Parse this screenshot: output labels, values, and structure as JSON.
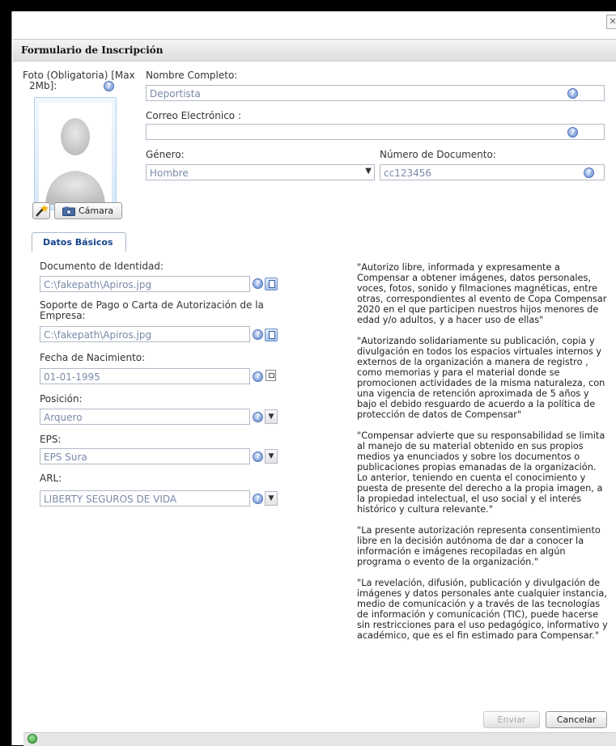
{
  "window": {
    "close_glyph": "✕"
  },
  "panel": {
    "title": "Formulario de Inscripción"
  },
  "photo": {
    "label_line1": "Foto (Obligatoria) [Max",
    "label_line2": "2Mb]:"
  },
  "name": {
    "label": "Nombre Completo:",
    "value": "Deportista"
  },
  "email": {
    "label": "Correo Electrónico :",
    "value": ""
  },
  "gender": {
    "label": "Género:",
    "value": "Hombre"
  },
  "doc_number": {
    "label": "Número de Documento:",
    "value": "cc123456"
  },
  "buttons": {
    "camera": "Cámara",
    "submit": "Enviar",
    "cancel": "Cancelar"
  },
  "tabs": [
    {
      "label": "Datos Básicos"
    }
  ],
  "basic": {
    "id_doc": {
      "label": "Documento de Identidad:",
      "value": "C:\\fakepath\\Apiros.jpg"
    },
    "payment": {
      "label_line1": "Soporte de Pago o Carta de Autorización de la",
      "label_line2": "Empresa:",
      "value": "C:\\fakepath\\Apiros.jpg"
    },
    "birth": {
      "label": "Fecha de Nacimiento:",
      "value": "01-01-1995"
    },
    "position": {
      "label": "Posición:",
      "value": "Arquero"
    },
    "eps": {
      "label": "EPS:",
      "value": "EPS Sura"
    },
    "arl": {
      "label": "ARL:",
      "value": "LIBERTY SEGUROS DE VIDA"
    }
  },
  "legal": [
    [
      "\"Autorizo libre, informada y expresamente a",
      "Compensar a obtener imágenes, datos personales,",
      "voces, fotos, sonido y filmaciones magnéticas, entre",
      "otras, correspondientes al evento de Copa Compensar",
      "2020 en el que participen nuestros hijos menores de",
      "edad y/o adultos, y a hacer uso de ellas\""
    ],
    [
      "\"Autorizando solidariamente su publicación, copia y",
      "divulgación en todos los espacios virtuales internos y",
      "externos de la organización a manera de registro ,",
      "como memorias y para el material donde se",
      "promocionen actividades de la misma naturaleza, con",
      "una vigencia de retención aproximada de 5 años y",
      "bajo el debido resguardo de acuerdo a la política de",
      "protección de datos de Compensar\""
    ],
    [
      "\"Compensar advierte que su responsabilidad se limita",
      "al manejo de su material obtenido en sus propios",
      "medios ya enunciados y sobre los documentos o",
      "publicaciones propias emanadas de la organización.",
      "Lo anterior, teniendo en cuenta el conocimiento y",
      "puesta de presente del derecho a la propia imagen, a",
      "la propiedad intelectual, el uso social y el interés",
      "histórico y cultura relevante.\""
    ],
    [
      "\"La presente autorización representa consentimiento",
      "libre en la decisión autónoma de dar a conocer la",
      "información e imágenes recopiladas en algún",
      "programa o evento de la organización.\""
    ],
    [
      "\"La revelación, difusión, publicación y divulgación de",
      "imágenes y datos personales ante cualquier instancia,",
      "medio de comunicación y a través de las tecnologías",
      "de información y comunicación (TIC), puede hacerse",
      "sin restricciones para el uso pedagógico, informativo y",
      "académico, que es el fin estimado para Compensar.\""
    ]
  ],
  "icons": {
    "help": "help-icon",
    "dropdown": "chevron-down-icon",
    "file": "file-browse-icon",
    "calendar": "calendar-icon",
    "wand": "wand-icon",
    "camera": "camera-icon",
    "status": "ok-status-icon"
  }
}
